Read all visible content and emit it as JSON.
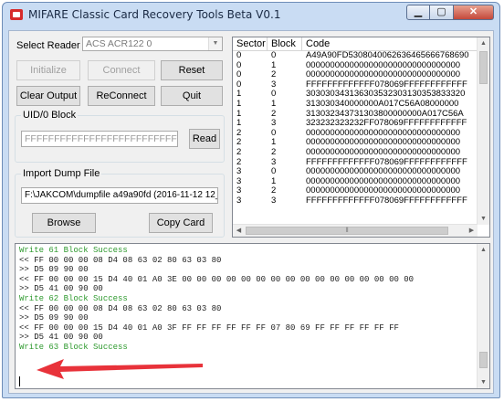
{
  "window": {
    "title": "MIFARE Classic Card Recovery Tools Beta V0.1",
    "controls": {
      "minimize": "▁",
      "maximize": "▢",
      "close": "✕"
    }
  },
  "reader": {
    "label": "Select Reader",
    "selected": "ACS ACR122 0"
  },
  "buttons": {
    "initialize": "Initialize",
    "connect": "Connect",
    "reset": "Reset",
    "clear_output": "Clear Output",
    "reconnect": "ReConnect",
    "quit": "Quit",
    "read": "Read",
    "browse": "Browse",
    "copy_card": "Copy Card"
  },
  "uid_block": {
    "legend": "UID/0 Block",
    "value": "FFFFFFFFFFFFFFFFFFFFFFFFFFFFFF"
  },
  "import_dump": {
    "legend": "Import Dump File",
    "path": "F:\\JAKCOM\\dumpfile a49a90fd (2016-11-12 12_20"
  },
  "grid": {
    "columns": [
      "Sector",
      "Block",
      "Code"
    ],
    "rows": [
      [
        "0",
        "0",
        "A49A90FD5308040062636465666768690"
      ],
      [
        "0",
        "1",
        "00000000000000000000000000000000"
      ],
      [
        "0",
        "2",
        "00000000000000000000000000000000"
      ],
      [
        "0",
        "3",
        "FFFFFFFFFFFFF078069FFFFFFFFFFFF"
      ],
      [
        "1",
        "0",
        "303030343136303532303130353833320"
      ],
      [
        "1",
        "1",
        "313030340000000A017C56A08000000"
      ],
      [
        "1",
        "2",
        "313032343731303800000000A017C56A"
      ],
      [
        "1",
        "3",
        "323232323232FF078069FFFFFFFFFFFF"
      ],
      [
        "2",
        "0",
        "00000000000000000000000000000000"
      ],
      [
        "2",
        "1",
        "00000000000000000000000000000000"
      ],
      [
        "2",
        "2",
        "00000000000000000000000000000000"
      ],
      [
        "2",
        "3",
        "FFFFFFFFFFFFF078069FFFFFFFFFFFF"
      ],
      [
        "3",
        "0",
        "00000000000000000000000000000000"
      ],
      [
        "3",
        "1",
        "00000000000000000000000000000000"
      ],
      [
        "3",
        "2",
        "00000000000000000000000000000000"
      ],
      [
        "3",
        "3",
        "FFFFFFFFFFFFF078069FFFFFFFFFFFF"
      ]
    ]
  },
  "log": {
    "lines": [
      {
        "text": "Write 61 Block Success",
        "ok": true
      },
      {
        "text": "<< FF 00 00 00 08 D4 08 63 02 80 63 03 80",
        "ok": false
      },
      {
        "text": ">> D5 09 90 00",
        "ok": false
      },
      {
        "text": "<< FF 00 00 00 15 D4 40 01 A0 3E 00 00 00 00 00 00 00 00 00 00 00 00 00 00 00 00",
        "ok": false
      },
      {
        "text": ">> D5 41 00 90 00",
        "ok": false
      },
      {
        "text": "Write 62 Block Success",
        "ok": true
      },
      {
        "text": "<< FF 00 00 00 08 D4 08 63 02 80 63 03 80",
        "ok": false
      },
      {
        "text": ">> D5 09 90 00",
        "ok": false
      },
      {
        "text": "<< FF 00 00 00 15 D4 40 01 A0 3F FF FF FF FF FF FF 07 80 69 FF FF FF FF FF FF",
        "ok": false
      },
      {
        "text": ">> D5 41 00 90 00",
        "ok": false
      },
      {
        "text": "Write 63 Block Success",
        "ok": true
      }
    ]
  },
  "colors": {
    "success_text": "#2f9a2f",
    "arrow": "#e8323a",
    "title_bar": "#c9dcf3"
  }
}
